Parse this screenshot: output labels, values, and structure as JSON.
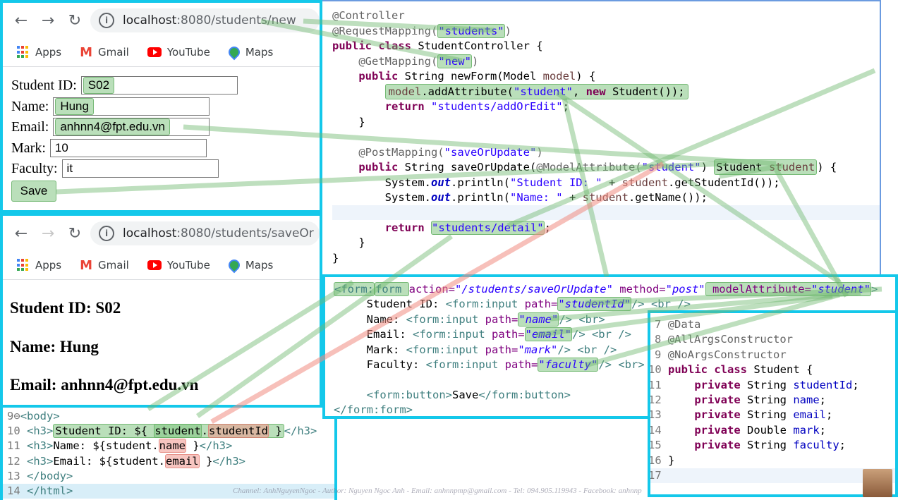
{
  "browser_top": {
    "url_host": "localhost",
    "url_rest": ":8080/students/new",
    "bookmarks": [
      "Apps",
      "Gmail",
      "YouTube",
      "Maps"
    ]
  },
  "form": {
    "fields": [
      {
        "label": "Student ID:",
        "value": "S02"
      },
      {
        "label": "Name:",
        "value": "Hung"
      },
      {
        "label": "Email:",
        "value": "anhnn4@fpt.edu.vn"
      },
      {
        "label": "Mark:",
        "value": "10"
      },
      {
        "label": "Faculty:",
        "value": "it"
      }
    ],
    "submit_label": "Save"
  },
  "browser_bottom": {
    "url_host": "localhost",
    "url_rest": ":8080/students/saveOr",
    "bookmarks": [
      "Apps",
      "Gmail",
      "YouTube",
      "Maps"
    ]
  },
  "detail": {
    "lines": [
      "Student ID: S02",
      "Name: Hung",
      "Email: anhnn4@fpt.edu.vn"
    ]
  },
  "controller_code": {
    "l1": "@Controller",
    "l2a": "@RequestMapping(",
    "l2b": "\"students\"",
    "l2c": ")",
    "l3a": "public class ",
    "l3b": "StudentController {",
    "l4a": "@GetMapping(",
    "l4b": "\"new\"",
    "l4c": ")",
    "l5a": "public ",
    "l5b": "String newForm(Model ",
    "l5c": "model",
    "l5d": ") {",
    "l6a": "model",
    "l6b": ".addAttribute(",
    "l6c": "\"student\"",
    "l6d": ", ",
    "l6e": "new ",
    "l6f": "Student());",
    "l7a": "return ",
    "l7b": "\"students/addOrEdit\"",
    "l7c": ";",
    "l8": "}",
    "l10a": "@PostMapping(",
    "l10b": "\"saveOrUpdate\"",
    "l10c": ")",
    "l11a": "public ",
    "l11b": "String saveOrUpdate(",
    "l11c": "@ModelAttribute(",
    "l11d": "\"student\"",
    "l11e": ") ",
    "l11f": "Student ",
    "l11g": "student",
    "l11h": ") {",
    "l12a": "System.",
    "l12b": "out",
    "l12c": ".println(",
    "l12d": "\"Student ID: \"",
    "l12e": " + ",
    "l12f": "student",
    "l12g": ".getStudentId());",
    "l13a": "System.",
    "l13b": "out",
    "l13c": ".println(",
    "l13d": "\"Name: \"",
    "l13e": " + ",
    "l13f": "student",
    "l13g": ".getName());",
    "l15a": "return ",
    "l15b": "\"students/detail\"",
    "l15c": ";",
    "l16": "}",
    "l17": "}"
  },
  "form_code": {
    "f1a": "<form:",
    "f1b": "form ",
    "f1c": "action=",
    "f1d": "\"/students/saveOrUpdate\"",
    "f1e": " method=",
    "f1f": "\"post\"",
    "f1g": " modelAttribute=",
    "f1h": "\"student\"",
    "f1i": ">",
    "f2a": "Student ID: ",
    "f2b": "<form:input ",
    "f2c": "path=",
    "f2d": "\"studentId\"",
    "f2e": "/> <br />",
    "f3a": "Name: ",
    "f3b": "<form:input ",
    "f3c": "path=",
    "f3d": "\"name\"",
    "f3e": "/> <br>",
    "f4a": "Email: ",
    "f4b": "<form:input ",
    "f4c": "path=",
    "f4d": "\"email\"",
    "f4e": "/> <br />",
    "f5a": "Mark: ",
    "f5b": "<form:input ",
    "f5c": "path=",
    "f5d": "\"mark\"",
    "f5e": "/> <br />",
    "f6a": "Faculty: ",
    "f6b": "<form:input ",
    "f6c": "path=",
    "f6d": "\"faculty\"",
    "f6e": "/> <br>",
    "f8a": "<form:button>",
    "f8b": "Save",
    "f8c": "</form:button>",
    "f9": "</form:form>"
  },
  "student_class": {
    "numbers": [
      "7",
      "8",
      "9",
      "10",
      "11",
      "12",
      "13",
      "14",
      "15",
      "16",
      "17"
    ],
    "c1": "@Data",
    "c2": "@AllArgsConstructor",
    "c3": "@NoArgsConstructor",
    "c4a": "public class ",
    "c4b": "Student {",
    "c5a": "private ",
    "c5b": "String ",
    "c5c": "studentId",
    "c6c": "name",
    "c7c": "email",
    "c8b": "Double ",
    "c8c": "mark",
    "c9c": "faculty",
    "semi": ";",
    "c10": "}"
  },
  "jsp_code": {
    "numbers": [
      "9",
      "10",
      "11",
      "12",
      "13",
      "14"
    ],
    "j1": "<body>",
    "j2a": "<h3>",
    "j2b": "Student ID: ${ ",
    "j2c": "student",
    "j2d": ".",
    "j2e": "studentId",
    "j2f": " }",
    "j2g": "</h3>",
    "j3a": "<h3>",
    "j3b": "Name: ${student.",
    "j3c": "name",
    "j3d": " }",
    "j3e": "</h3>",
    "j4a": "<h3>",
    "j4b": "Email: ${student.",
    "j4c": "email",
    "j4d": " }",
    "j4e": "</h3>",
    "j5": "</body>",
    "j6": "</html>"
  },
  "watermark": "Channel: AnhNguyenNgoc - Author: Nguyen Ngoc Anh - Email: anhnnpmp@gmail.com - Tel: 094.905.119943 - Facebook: anhnnp",
  "colors": {
    "panel_border": "#14c8ea",
    "highlight_green": "#81c481",
    "highlight_red": "#f0968c"
  }
}
